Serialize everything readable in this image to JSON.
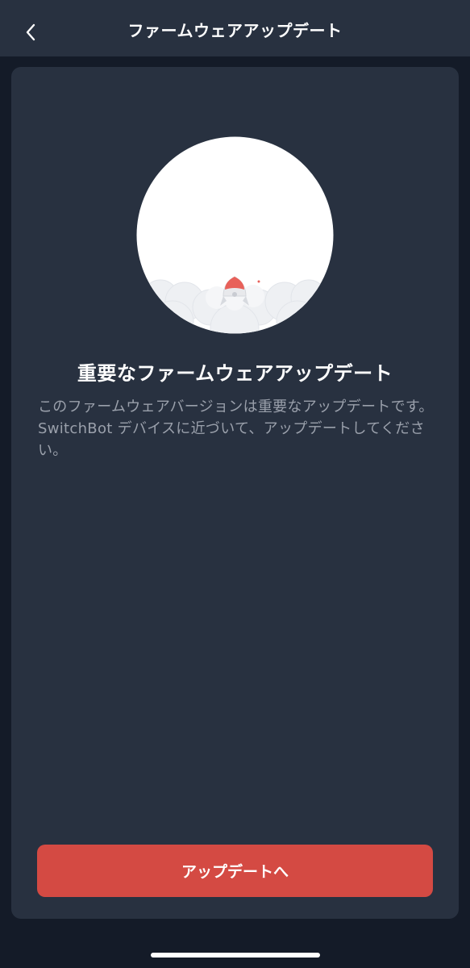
{
  "nav": {
    "title": "ファームウェアアップデート",
    "back_icon": "chevron-left-icon"
  },
  "illustration": {
    "icon": "rocket-icon",
    "accent_color": "#e8615a"
  },
  "content": {
    "headline": "重要なファームウェアアップデート",
    "description": "このファームウェアバージョンは重要なアップデートです。SwitchBot デバイスに近づいて、アップデートしてください。"
  },
  "actions": {
    "update_label": "アップデートへ",
    "update_color": "#d44a43"
  }
}
